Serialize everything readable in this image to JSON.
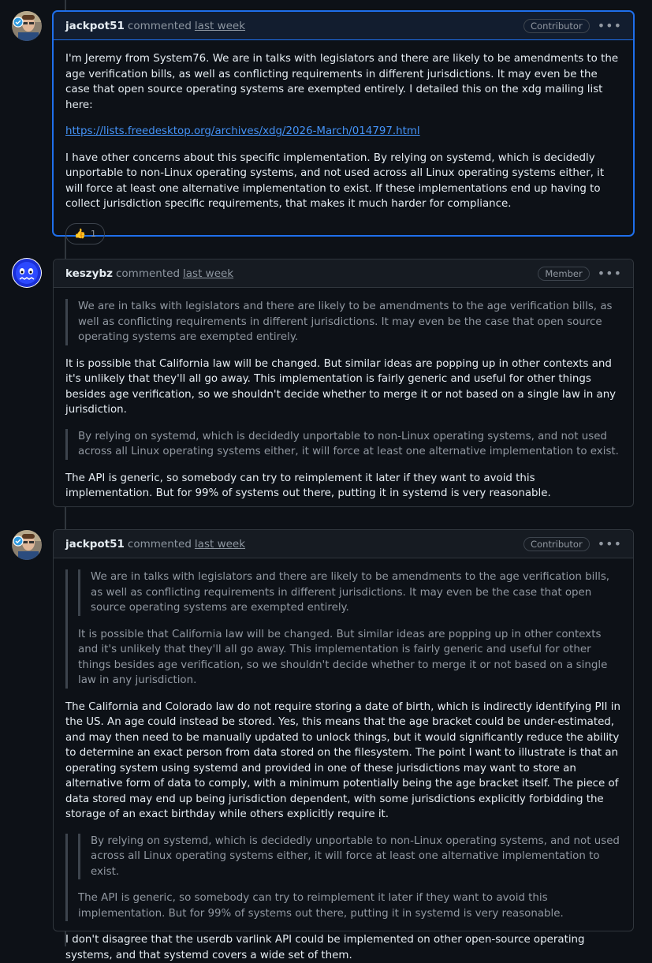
{
  "comments": [
    {
      "author": "jackpot51",
      "verb": "commented",
      "time": "last week",
      "badge": "Contributor",
      "paragraphs": [
        "I'm Jeremy from System76. We are in talks with legislators and there are likely to be amendments to the age verification bills, as well as conflicting requirements in different jurisdictions. It may even be the case that open source operating systems are exempted entirely. I detailed this on the xdg mailing list here:",
        "I have other concerns about this specific implementation. By relying on systemd, which is decidedly unportable to non-Linux operating systems, and not used across all Linux operating systems either, it will force at least one alternative implementation to exist. If these implementations end up having to collect jurisdiction specific requirements, that makes it much harder for compliance."
      ],
      "link": "https://lists.freedesktop.org/archives/xdg/2026-March/014797.html",
      "reaction": {
        "emoji": "👍",
        "count": "1"
      }
    },
    {
      "author": "keszybz",
      "verb": "commented",
      "time": "last week",
      "badge": "Member",
      "quote1": "We are in talks with legislators and there are likely to be amendments to the age verification bills, as well as conflicting requirements in different jurisdictions. It may even be the case that open source operating systems are exempted entirely.",
      "para1": "It is possible that California law will be changed. But similar ideas are popping up in other contexts and it's unlikely that they'll all go away. This implementation is fairly generic and useful for other things besides age verification, so we shouldn't decide whether to merge it or not based on a single law in any jurisdiction.",
      "quote2": "By relying on systemd, which is decidedly unportable to non-Linux operating systems, and not used across all Linux operating systems either, it will force at least one alternative implementation to exist.",
      "para2": "The API is generic, so somebody can try to reimplement it later if they want to avoid this implementation. But for 99% of systems out there, putting it in systemd is very reasonable."
    },
    {
      "author": "jackpot51",
      "verb": "commented",
      "time": "last week",
      "badge": "Contributor",
      "quote1_nested": "We are in talks with legislators and there are likely to be amendments to the age verification bills, as well as conflicting requirements in different jurisdictions. It may even be the case that open source operating systems are exempted entirely.",
      "quote1_text": "It is possible that California law will be changed. But similar ideas are popping up in other contexts and it's unlikely that they'll all go away. This implementation is fairly generic and useful for other things besides age verification, so we shouldn't decide whether to merge it or not based on a single law in any jurisdiction.",
      "para1": "The California and Colorado law do not require storing a date of birth, which is indirectly identifying PII in the US. An age could instead be stored. Yes, this means that the age bracket could be under-estimated, and may then need to be manually updated to unlock things, but it would significantly reduce the ability to determine an exact person from data stored on the filesystem. The point I want to illustrate is that an operating system using systemd and provided in one of these jurisdictions may want to store an alternative form of data to comply, with a minimum potentially being the age bracket itself. The piece of data stored may end up being jurisdiction dependent, with some jurisdictions explicitly forbidding the storage of an exact birthday while others explicitly require it.",
      "quote2_nested": "By relying on systemd, which is decidedly unportable to non-Linux operating systems, and not used across all Linux operating systems either, it will force at least one alternative implementation to exist.",
      "quote2_text": "The API is generic, so somebody can try to reimplement it later if they want to avoid this implementation. But for 99% of systems out there, putting it in systemd is very reasonable.",
      "para2": "I don't disagree that the userdb varlink API could be implemented on other open-source operating systems, and that systemd covers a wide set of them."
    }
  ],
  "colors": {
    "background": "#0d1117",
    "border": "#30363d",
    "highlight": "#1f6feb",
    "link": "#4493f8",
    "muted": "#9198a1"
  }
}
